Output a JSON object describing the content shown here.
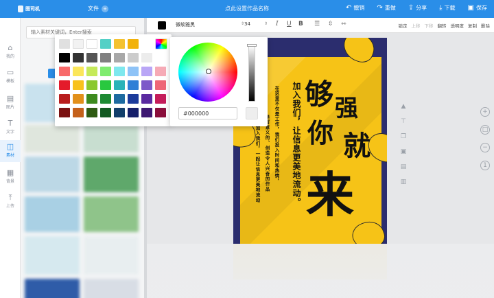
{
  "app": {
    "logo_text": "图司机",
    "title": "点此设置作品名称",
    "doc_menu": "文件",
    "doc_menu_icon": "+"
  },
  "top_actions": [
    {
      "icon": "↶",
      "label": "撤销"
    },
    {
      "icon": "↷",
      "label": "重做"
    },
    {
      "icon": "⇪",
      "label": "分享"
    },
    {
      "icon": "⤓",
      "label": "下载"
    },
    {
      "icon": "▣",
      "label": "保存"
    }
  ],
  "rail": [
    {
      "icon": "⌂",
      "label": "我的"
    },
    {
      "icon": "▭",
      "label": "模板"
    },
    {
      "icon": "▤",
      "label": "图片"
    },
    {
      "icon": "T",
      "label": "文字"
    },
    {
      "icon": "◫",
      "label": "素材"
    },
    {
      "icon": "▦",
      "label": "背景"
    },
    {
      "icon": "⤒",
      "label": "上传"
    }
  ],
  "panel": {
    "search_placeholder": "输入素材关键词，Enter搜索"
  },
  "format": {
    "font": "微软雅黑",
    "size": "34",
    "italic": "I",
    "underline": "U",
    "bold": "B",
    "right_labels": [
      "锁定",
      "上移",
      "下移",
      "翻转",
      "透明度",
      "复制",
      "删除"
    ]
  },
  "poster": {
    "big_chars": [
      "够",
      "强",
      "你",
      "就",
      "来"
    ],
    "lines": [
      "加入我们，让信息更美地流动。",
      "在这里不仅是工作，我们投入时间和热情，",
      "是有意义的、创造令人兴奋的作品",
      "加入我们，一起让信息更美地流动"
    ]
  },
  "palette": {
    "colors": [
      [
        "#e0e0e0",
        "#f2f2f2",
        "#ffffff",
        "#53d0c6",
        "#f4c230",
        "#f2b20a"
      ],
      [
        "#000000",
        "#333333",
        "#555555",
        "#808080",
        "#a8a8a8",
        "#cccccc",
        "#ececec"
      ],
      [
        "#f86a6a",
        "#fbe65a",
        "#c5ea5a",
        "#7fec6f",
        "#7ee8ee",
        "#8ec3f7",
        "#b9a6f6",
        "#f6aab6"
      ],
      [
        "#e41b2b",
        "#f8c21c",
        "#8ac82e",
        "#29c83f",
        "#29b3b9",
        "#2f7fd6",
        "#7d59c9",
        "#ee6677"
      ],
      [
        "#b81d1d",
        "#e2901b",
        "#3d8a1e",
        "#1e8a34",
        "#1d6aa0",
        "#1c3b9b",
        "#5a2aa0",
        "#c41c5a"
      ],
      [
        "#7a1111",
        "#c4601a",
        "#2e5a12",
        "#135a22",
        "#123f6b",
        "#151f6a",
        "#3e1872",
        "#8a0e3b"
      ]
    ]
  },
  "picker": {
    "hex": "#000000"
  },
  "icons": {
    "wheel": "color-wheel-icon",
    "plus": "zoom-in-icon",
    "minus": "zoom-out-icon"
  }
}
